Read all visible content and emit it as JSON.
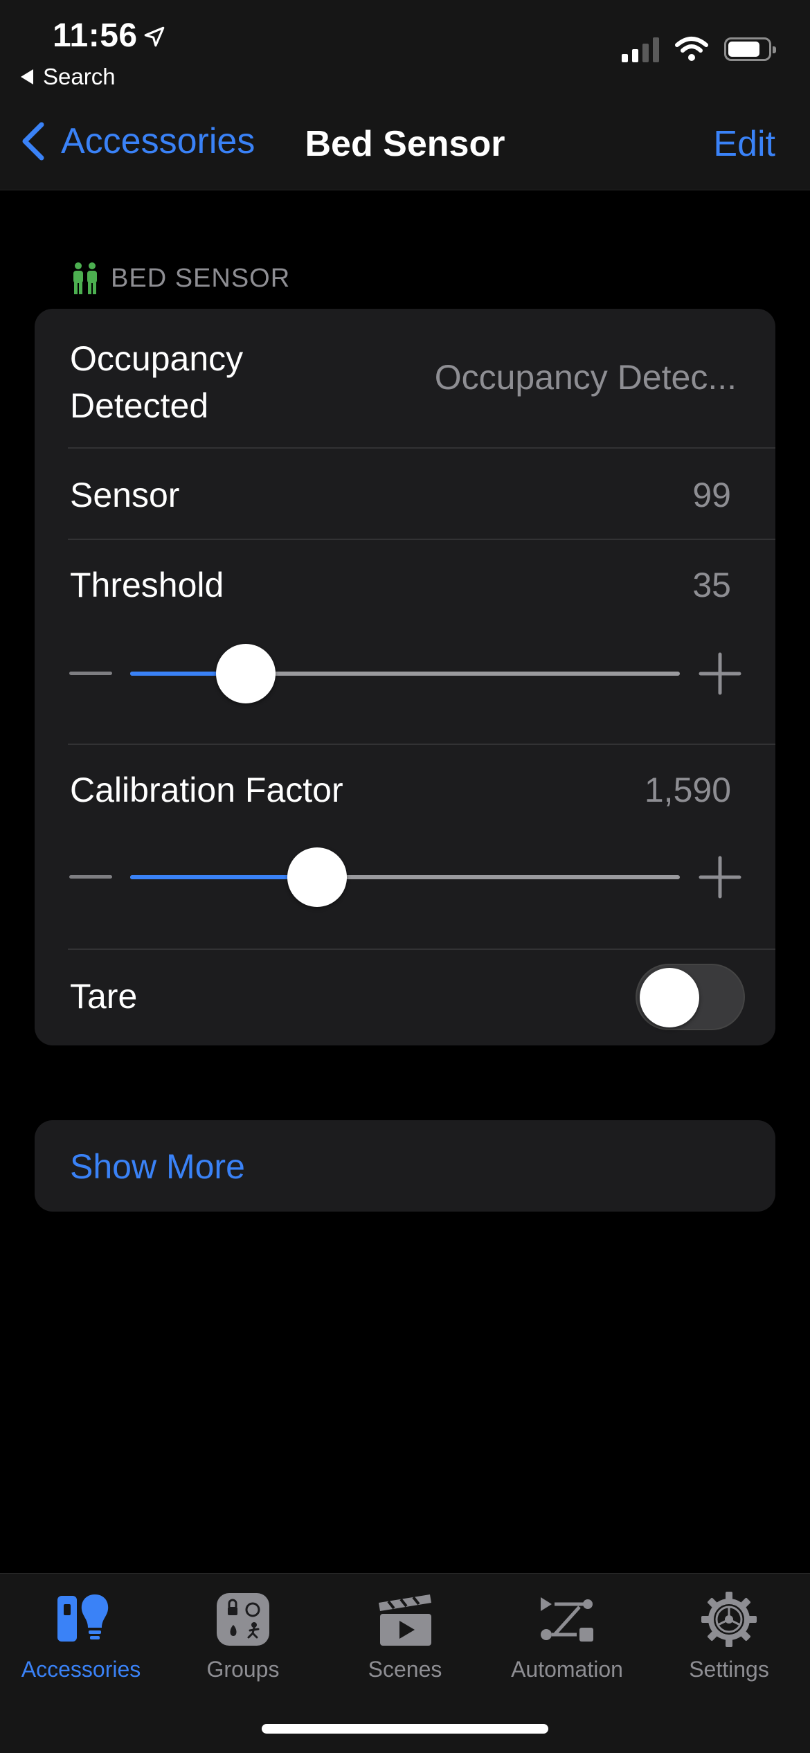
{
  "status_bar": {
    "time": "11:56",
    "back_app": "Search",
    "icons": [
      "location-arrow-icon",
      "cellular-signal-icon",
      "wifi-icon",
      "battery-icon"
    ]
  },
  "nav": {
    "back_label": "Accessories",
    "title": "Bed Sensor",
    "edit_label": "Edit",
    "accent_color": "#3a82f7"
  },
  "section": {
    "header": "BED SENSOR",
    "icon": "people-icon",
    "icon_color": "#4caf50"
  },
  "rows": {
    "occupancy": {
      "label_line1": "Occupancy",
      "label_line2": "Detected",
      "value": "Occupancy Detec..."
    },
    "sensor": {
      "label": "Sensor",
      "value": "99"
    },
    "threshold": {
      "label": "Threshold",
      "value": "35",
      "slider_fraction": 0.21
    },
    "calibration": {
      "label": "Calibration Factor",
      "value": "1,590",
      "slider_fraction": 0.34
    },
    "tare": {
      "label": "Tare",
      "toggle_on": false
    }
  },
  "show_more": {
    "label": "Show More"
  },
  "tabbar": {
    "tabs": [
      {
        "label": "Accessories",
        "icon": "accessories-icon",
        "active": true
      },
      {
        "label": "Groups",
        "icon": "groups-icon",
        "active": false
      },
      {
        "label": "Scenes",
        "icon": "scenes-icon",
        "active": false
      },
      {
        "label": "Automation",
        "icon": "automation-icon",
        "active": false
      },
      {
        "label": "Settings",
        "icon": "settings-icon",
        "active": false
      }
    ]
  }
}
